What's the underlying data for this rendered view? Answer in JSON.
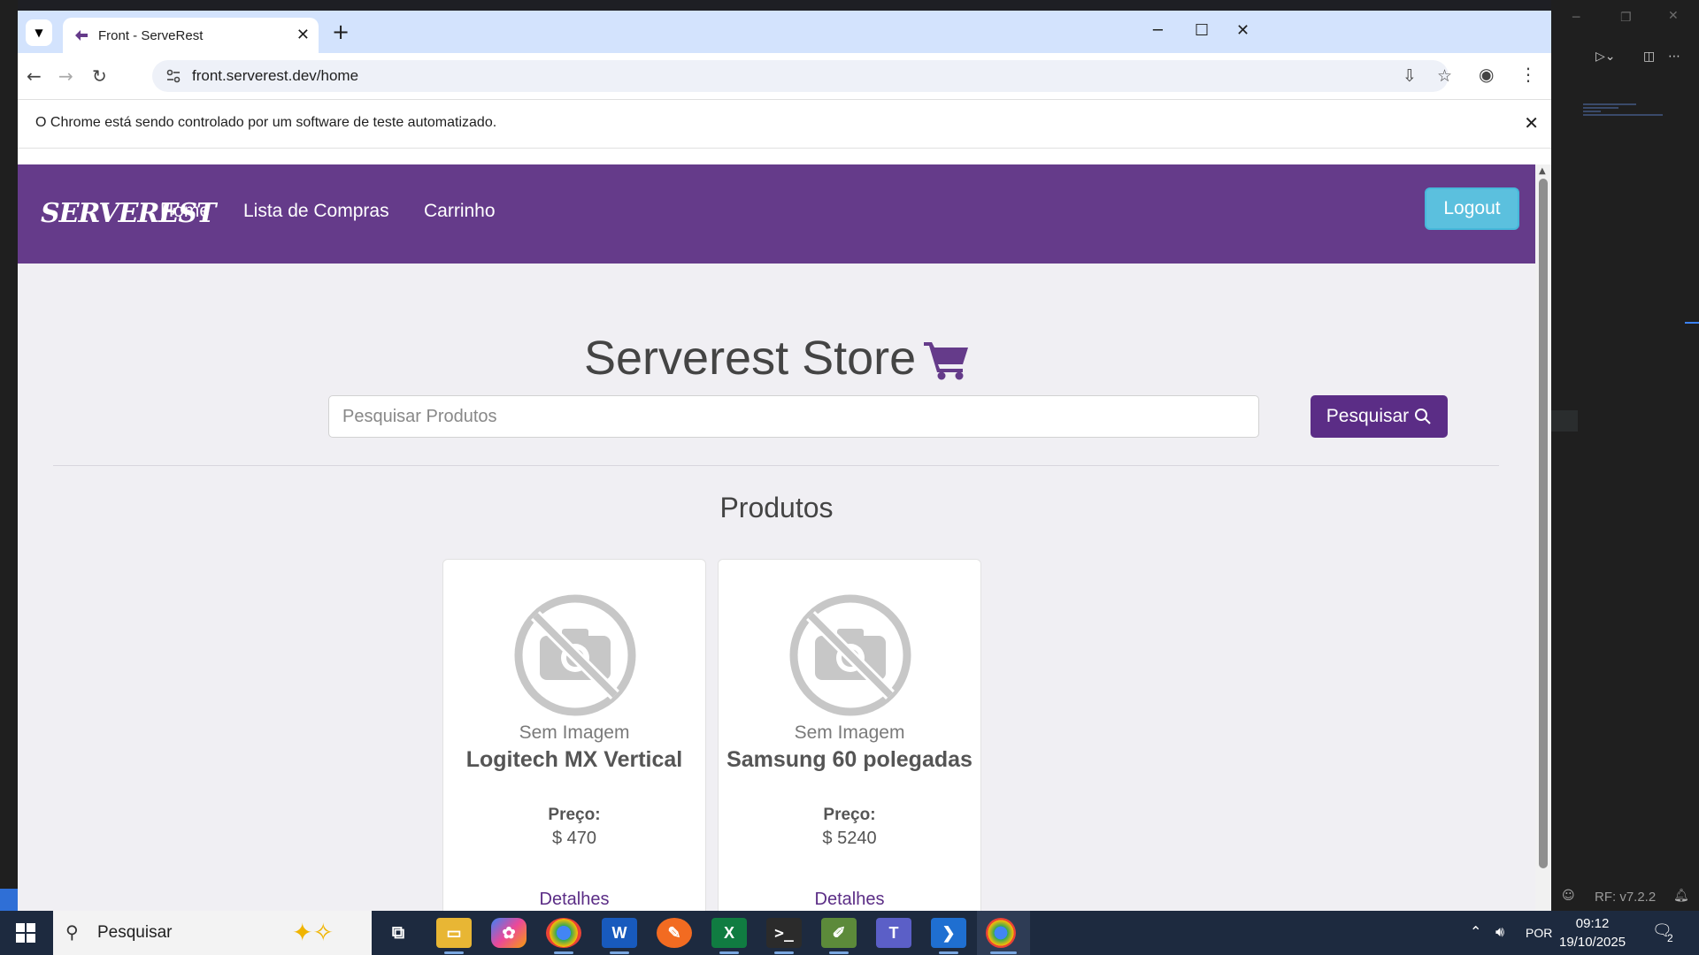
{
  "browser": {
    "tab_title": "Front - ServeRest",
    "url": "front.serverest.dev/home",
    "infobar_message": "O Chrome está sendo controlado por um software de teste automatizado."
  },
  "site": {
    "logo": "SERVEREST",
    "nav": [
      "Home",
      "Lista de Compras",
      "Carrinho"
    ],
    "logout_label": "Logout",
    "store_title": "Serverest Store",
    "search_placeholder": "Pesquisar Produtos",
    "search_button": "Pesquisar",
    "section_title": "Produtos",
    "products": [
      {
        "image_text": "Sem Imagem",
        "name": "Logitech MX Vertical",
        "price_label": "Preço:",
        "price": "$ 470",
        "details": "Detalhes"
      },
      {
        "image_text": "Sem Imagem",
        "name": "Samsung 60 polegadas",
        "price_label": "Preço:",
        "price": "$ 5240",
        "details": "Detalhes"
      }
    ]
  },
  "editor": {
    "footer": "RF: v7.2.2"
  },
  "taskbar": {
    "search_label": "Pesquisar",
    "language": "POR",
    "time": "09:12",
    "date": "19/10/2025",
    "notification_count": "2"
  },
  "colors": {
    "brand_purple": "#653b8a",
    "button_purple": "#5b2d86",
    "logout_blue": "#5bc0de"
  }
}
